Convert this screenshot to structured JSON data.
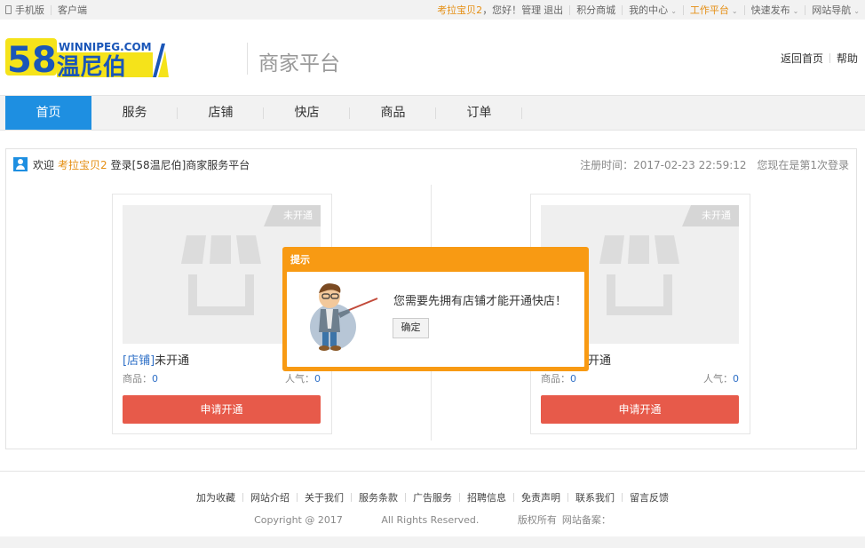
{
  "topbar": {
    "mobile": "手机版",
    "client": "客户端",
    "username": "考拉宝贝2",
    "greeting": "，您好！",
    "manage": "管理",
    "logout": "退出",
    "points_mall": "积分商城",
    "my_center": "我的中心",
    "workbench": "工作平台",
    "quick_post": "快速发布",
    "site_nav": "网站导航"
  },
  "header": {
    "logo_text_top": "WINNIPEG.COM",
    "logo_num": "58",
    "logo_cn": "温尼伯",
    "platform_title": "商家平台",
    "back_home": "返回首页",
    "help": "帮助"
  },
  "nav": {
    "items": [
      {
        "label": "首页"
      },
      {
        "label": "服务"
      },
      {
        "label": "店铺"
      },
      {
        "label": "快店"
      },
      {
        "label": "商品"
      },
      {
        "label": "订单"
      }
    ]
  },
  "welcome": {
    "prefix": "欢迎",
    "username": "考拉宝贝2",
    "suffix": "登录[58温尼伯]商家服务平台",
    "register_time": "注册时间：2017-02-23 22:59:12",
    "login_count": "您现在是第1次登录"
  },
  "cards": [
    {
      "badge": "未开通",
      "type_label": "[店铺]",
      "status": "未开通",
      "goods_label": "商品：",
      "goods_count": "0",
      "pop_label": "人气：",
      "pop_count": "0",
      "button": "申请开通"
    },
    {
      "badge": "未开通",
      "type_label": "",
      "status": "未开通",
      "goods_label": "商品：",
      "goods_count": "0",
      "pop_label": "人气：",
      "pop_count": "0",
      "button": "申请开通"
    }
  ],
  "modal": {
    "title": "提示",
    "message": "您需要先拥有店铺才能开通快店！",
    "ok": "确定"
  },
  "footer": {
    "links": [
      "加为收藏",
      "网站介绍",
      "关于我们",
      "服务条款",
      "广告服务",
      "招聘信息",
      "免责声明",
      "联系我们",
      "留言反馈"
    ],
    "copyright": "Copyright @ 2017",
    "rights": "All Rights Reserved.",
    "owner": "版权所有",
    "icp": "网站备案："
  },
  "colors": {
    "nav_active": "#1e8fe1",
    "accent_orange": "#f89a13",
    "button_red": "#e75a4a",
    "link_blue": "#2f70c7"
  }
}
